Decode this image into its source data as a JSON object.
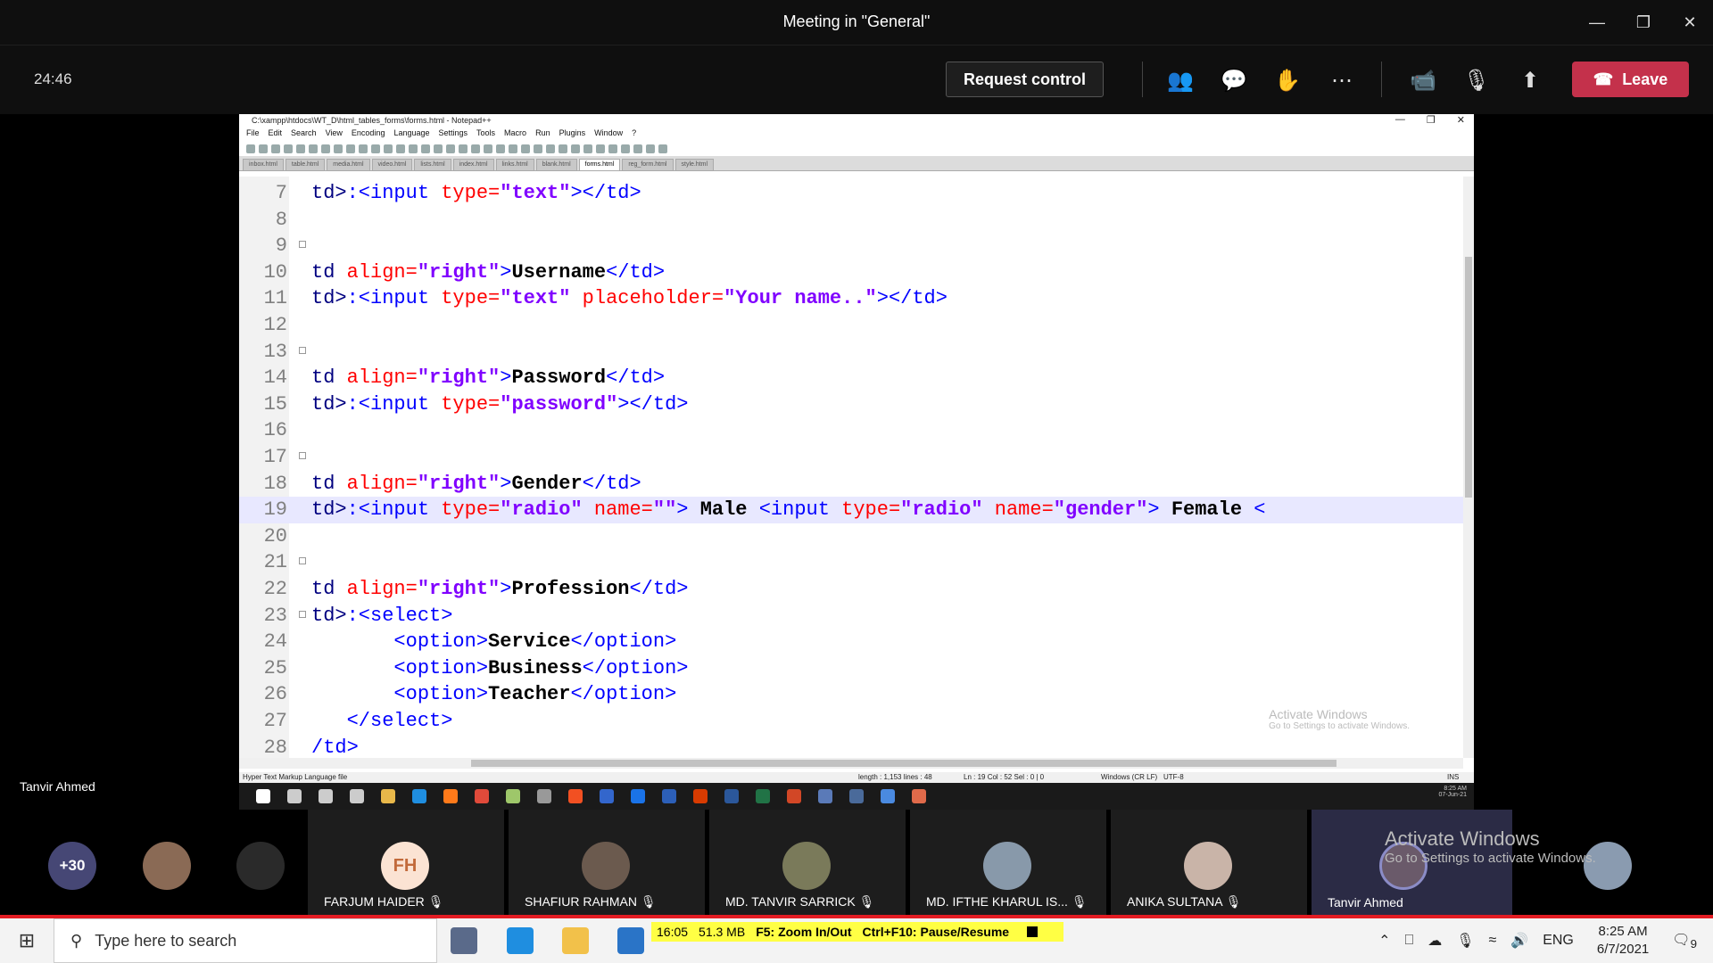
{
  "teams": {
    "window_title": "Meeting in \"General\"",
    "timer": "24:46",
    "request_control": "Request control",
    "leave": "Leave"
  },
  "notepad": {
    "title": "C:\\xampp\\htdocs\\WT_D\\html_tables_forms\\forms.html - Notepad++",
    "menu": [
      "File",
      "Edit",
      "Search",
      "View",
      "Encoding",
      "Language",
      "Settings",
      "Tools",
      "Macro",
      "Run",
      "Plugins",
      "Window",
      "?"
    ],
    "tabs": [
      "inbox.html",
      "table.html",
      "media.html",
      "video.html",
      "lists.html",
      "index.html",
      "links.html",
      "blank.html",
      "forms.html",
      "reg_form.html",
      "style.html"
    ],
    "active_tab": "forms.html",
    "line_numbers": [
      "7",
      "8",
      "9",
      "10",
      "11",
      "12",
      "13",
      "14",
      "15",
      "16",
      "17",
      "18",
      "19",
      "20",
      "21",
      "22",
      "23",
      "24",
      "25",
      "26",
      "27",
      "28"
    ],
    "status": {
      "type": "Hyper Text Markup Language file",
      "length": "length : 1,153    lines : 48",
      "position": "Ln : 19    Col : 52    Sel : 0 | 0",
      "eol": "Windows (CR LF)",
      "encoding": "UTF-8",
      "mode": "INS"
    },
    "activate_title": "Activate Windows",
    "activate_sub": "Go to Settings to activate Windows.",
    "inner_time": "8:25 AM",
    "inner_date": "07-Jun-21"
  },
  "presenter_name": "Tanvir Ahmed",
  "participants": {
    "more_count": "+30",
    "fh_initials": "FH",
    "names": [
      "FARJUM HAIDER",
      "SHAFIUR RAHMAN",
      "MD. TANVIR SARRICK",
      "MD. IFTHE KHARUL IS...",
      "ANIKA SULTANA",
      "Tanvir Ahmed"
    ],
    "watermark_title": "Activate Windows",
    "watermark_sub": "Go to Settings to activate Windows."
  },
  "taskbar": {
    "search_placeholder": "Type here to search",
    "recorder_time": "16:05",
    "recorder_size": "51.3 MB",
    "recorder_zoom": "F5: Zoom In/Out",
    "recorder_pause": "Ctrl+F10: Pause/Resume",
    "language": "ENG",
    "time": "8:25 AM",
    "date": "6/7/2021",
    "notification_count": "9"
  },
  "colors": {
    "leave": "#c4314b",
    "code_tag": "#0000ff",
    "code_attr": "#ff0000",
    "code_string": "#8000ff",
    "recorder_bg": "#ffff44"
  }
}
